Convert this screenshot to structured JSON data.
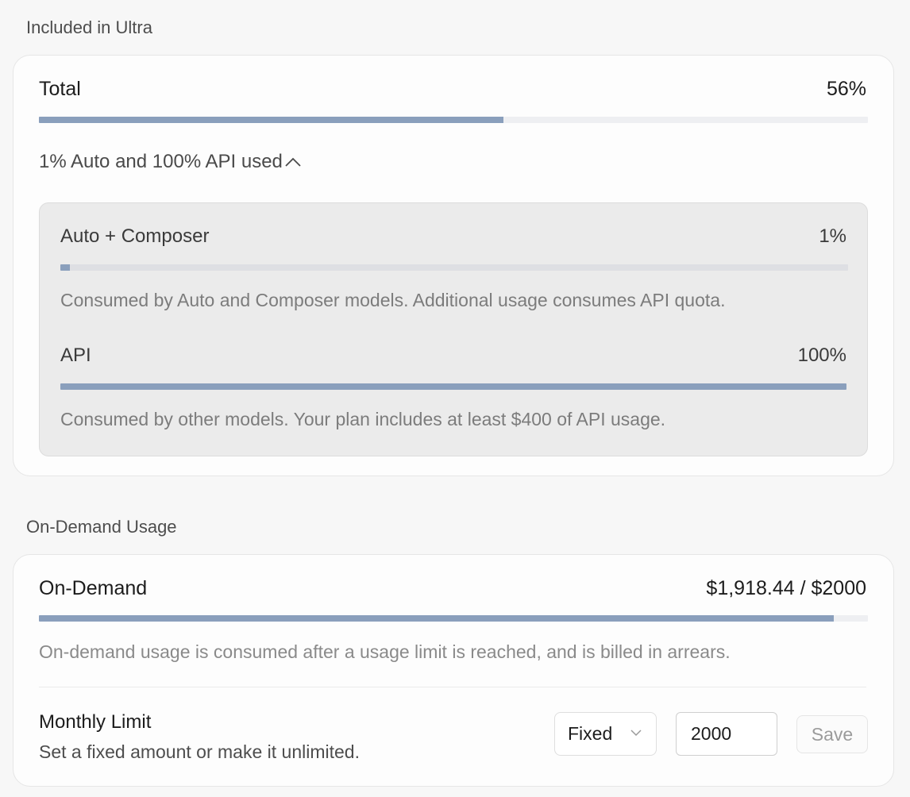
{
  "included_section": {
    "label": "Included in Ultra",
    "total": {
      "label": "Total",
      "value": "56%",
      "progress": 0.56
    },
    "breakdown_toggle": "1% Auto and 100% API used",
    "breakdown_toggle_icon": "chevron-up-icon",
    "items": [
      {
        "label": "Auto + Composer",
        "value": "1%",
        "progress": 0.01,
        "description": "Consumed by Auto and Composer models. Additional usage consumes API quota."
      },
      {
        "label": "API",
        "value": "100%",
        "progress": 1.0,
        "description": "Consumed by other models. Your plan includes at least $400 of API usage."
      }
    ]
  },
  "on_demand_section": {
    "label": "On-Demand Usage",
    "usage": {
      "label": "On-Demand",
      "value": "$1,918.44 / $2000",
      "progress": 0.959,
      "description": "On-demand usage is consumed after a usage limit is reached, and is billed in arrears."
    },
    "monthly_limit": {
      "title": "Monthly Limit",
      "subtitle": "Set a fixed amount or make it unlimited.",
      "mode_selected": "Fixed",
      "mode_icon": "chevron-down-icon",
      "amount_value": "2000",
      "save_label": "Save"
    }
  },
  "colors": {
    "progress_fill": "#8a9fbc",
    "track": "#eeeff2",
    "card_bg": "#fdfdfd",
    "page_bg": "#f7f7f7"
  }
}
